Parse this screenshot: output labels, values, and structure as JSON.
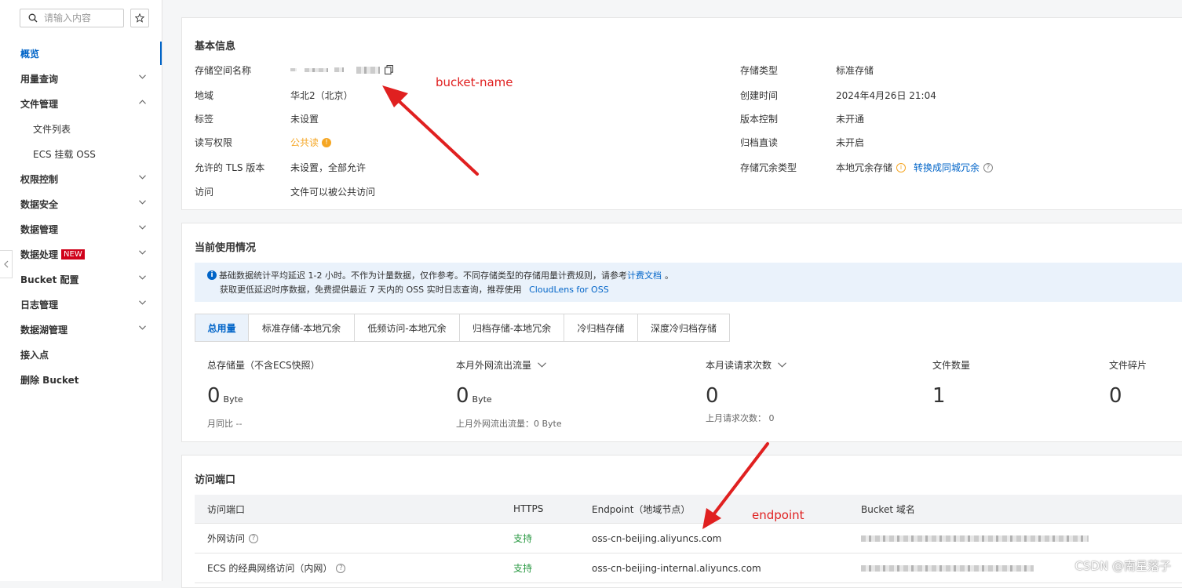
{
  "search": {
    "placeholder": "请输入内容"
  },
  "sidebar": {
    "items": [
      {
        "label": "概览"
      },
      {
        "label": "用量查询"
      },
      {
        "label": "文件管理"
      },
      {
        "label": "文件列表"
      },
      {
        "label": "ECS 挂载 OSS"
      },
      {
        "label": "权限控制"
      },
      {
        "label": "数据安全"
      },
      {
        "label": "数据管理"
      },
      {
        "label": "数据处理",
        "badge": "NEW"
      },
      {
        "label": "Bucket 配置"
      },
      {
        "label": "日志管理"
      },
      {
        "label": "数据湖管理"
      },
      {
        "label": "接入点"
      },
      {
        "label": "删除 Bucket"
      }
    ]
  },
  "basic": {
    "title": "基本信息",
    "left": [
      {
        "label": "存储空间名称",
        "value": ""
      },
      {
        "label": "地域",
        "value": "华北2（北京）"
      },
      {
        "label": "标签",
        "value": "未设置"
      },
      {
        "label": "读写权限",
        "value": "公共读"
      },
      {
        "label": "允许的 TLS 版本",
        "value": "未设置，全部允许"
      },
      {
        "label": "访问",
        "value": "文件可以被公共访问"
      }
    ],
    "right": [
      {
        "label": "存储类型",
        "value": "标准存储"
      },
      {
        "label": "创建时间",
        "value": "2024年4月26日 21:04"
      },
      {
        "label": "版本控制",
        "value": "未开通"
      },
      {
        "label": "归档直读",
        "value": "未开启"
      },
      {
        "label": "存储冗余类型",
        "value": "本地冗余存储"
      }
    ],
    "convert_link": "转换成同城冗余"
  },
  "usage": {
    "title": "当前使用情况",
    "notice_line1_a": "基础数据统计平均延迟 1-2 小时。不作为计量数据，仅作参考。不同存储类型的存储用量计费规则，请参考",
    "notice_link1": "计费文档",
    "notice_line1_b": "。",
    "notice_line2_a": "获取更低延迟时序数据，免费提供最近 7 天内的 OSS 实时日志查询，推荐使用",
    "notice_link2": "CloudLens for OSS",
    "tabs": [
      "总用量",
      "标准存储-本地冗余",
      "低频访问-本地冗余",
      "归档存储-本地冗余",
      "冷归档存储",
      "深度冷归档存储"
    ],
    "stats": [
      {
        "label": "总存储量（不含ECS快照）",
        "value": "0",
        "unit": "Byte",
        "sub": "月同比  --"
      },
      {
        "label": "本月外网流出流量",
        "value": "0",
        "unit": "Byte",
        "sub": "上月外网流出流量：0 Byte"
      },
      {
        "label": "本月读请求次数",
        "value": "0",
        "unit": "",
        "sub": "上月请求次数：  0"
      },
      {
        "label": "文件数量",
        "value": "1",
        "unit": "",
        "sub": ""
      },
      {
        "label": "文件碎片",
        "value": "0",
        "unit": "",
        "sub": ""
      }
    ]
  },
  "endpoints": {
    "title": "访问端口",
    "headers": [
      "访问端口",
      "HTTPS",
      "Endpoint（地域节点）",
      "Bucket 域名"
    ],
    "rows": [
      {
        "name": "外网访问",
        "https": "支持",
        "endpoint": "oss-cn-beijing.aliyuncs.com"
      },
      {
        "name": "ECS 的经典网络访问（内网）",
        "https": "支持",
        "endpoint": "oss-cn-beijing-internal.aliyuncs.com"
      }
    ]
  },
  "annotations": {
    "bucket": "bucket-name",
    "endpoint": "endpoint"
  },
  "watermark": "CSDN @南星落子",
  "colors": {
    "accent": "#0064c8",
    "annotation": "#e02020",
    "success": "#2b9a44",
    "warning": "#f5a623"
  }
}
